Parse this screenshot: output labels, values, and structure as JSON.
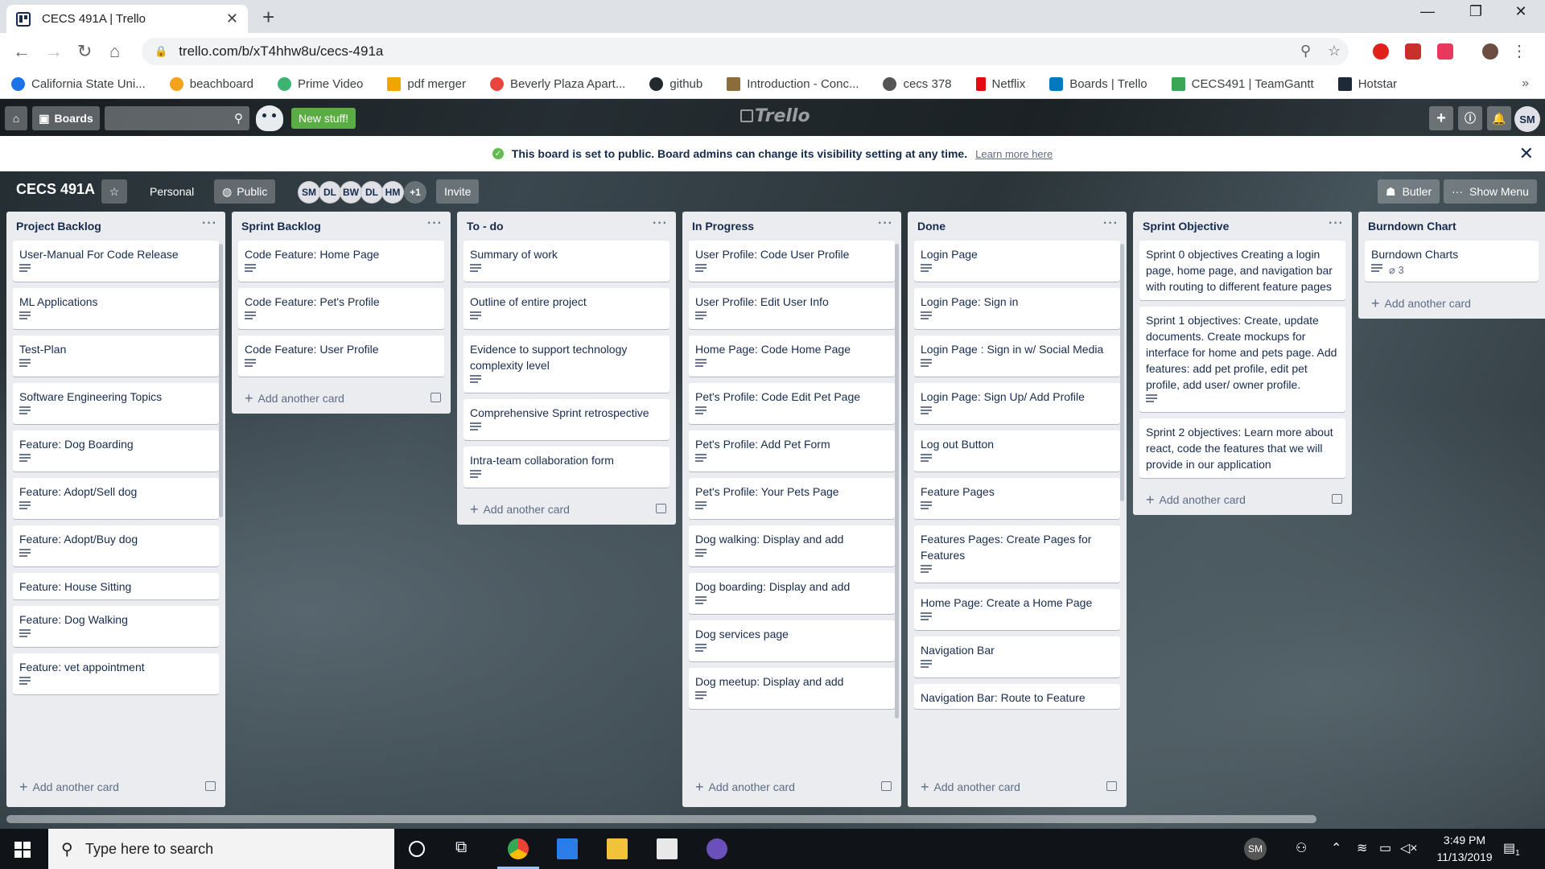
{
  "browser": {
    "tab_title": "CECS 491A | Trello",
    "url": "trello.com/b/xT4hhw8u/cecs-491a",
    "bookmarks": [
      {
        "label": "California State Uni...",
        "color": "#1a73e8"
      },
      {
        "label": "beachboard",
        "color": "#f4a11d"
      },
      {
        "label": "Prime Video",
        "color": "#3cb371"
      },
      {
        "label": "pdf merger",
        "color": "#f0a500"
      },
      {
        "label": "Beverly Plaza Apart...",
        "color": "#e8453c"
      },
      {
        "label": "github",
        "color": "#24292e"
      },
      {
        "label": "Introduction - Conc...",
        "color": "#8a6d3b"
      },
      {
        "label": "cecs 378",
        "color": "#555555"
      },
      {
        "label": "Netflix",
        "color": "#e50914"
      },
      {
        "label": "Boards | Trello",
        "color": "#0079bf"
      },
      {
        "label": "CECS491 | TeamGantt",
        "color": "#3aa757"
      },
      {
        "label": "Hotstar",
        "color": "#1f2a38"
      }
    ]
  },
  "trello": {
    "boards_label": "Boards",
    "new_stuff": "New stuff!",
    "logo": "Trello",
    "user_initials": "SM"
  },
  "notice": {
    "message": "This board is set to public. Board admins can change its visibility setting at any time.",
    "link": "Learn more here"
  },
  "board": {
    "title": "CECS 491A",
    "team": "Personal",
    "visibility": "Public",
    "members": [
      "SM",
      "DL",
      "BW",
      "DL",
      "HM"
    ],
    "extra_members": "+1",
    "invite": "Invite",
    "butler": "Butler",
    "show_menu": "Show Menu",
    "add_card_label": "Add another card"
  },
  "lists": [
    {
      "title": "Project Backlog",
      "cards": [
        {
          "text": "User-Manual For Code Release",
          "desc": true
        },
        {
          "text": "ML Applications",
          "desc": true
        },
        {
          "text": "Test-Plan",
          "desc": true
        },
        {
          "text": "Software Engineering Topics",
          "desc": true
        },
        {
          "text": "Feature: Dog Boarding",
          "desc": true
        },
        {
          "text": "Feature: Adopt/Sell dog",
          "desc": true
        },
        {
          "text": "Feature: Adopt/Buy dog",
          "desc": true
        },
        {
          "text": "Feature: House Sitting",
          "desc": false
        },
        {
          "text": "Feature: Dog Walking",
          "desc": true
        },
        {
          "text": "Feature: vet appointment",
          "desc": true
        }
      ]
    },
    {
      "title": "Sprint Backlog",
      "cards": [
        {
          "text": "Code Feature: Home Page",
          "desc": true
        },
        {
          "text": "Code Feature: Pet's Profile",
          "desc": true
        },
        {
          "text": "Code Feature: User Profile",
          "desc": true
        }
      ]
    },
    {
      "title": "To - do",
      "cards": [
        {
          "text": "Summary of work",
          "desc": true
        },
        {
          "text": "Outline of entire project",
          "desc": true
        },
        {
          "text": "Evidence to support technology complexity level",
          "desc": true
        },
        {
          "text": "Comprehensive Sprint retrospective",
          "desc": true
        },
        {
          "text": "Intra-team collaboration form",
          "desc": true
        }
      ]
    },
    {
      "title": "In Progress",
      "cards": [
        {
          "text": "User Profile: Code User Profile",
          "desc": true
        },
        {
          "text": "User Profile: Edit User Info",
          "desc": true
        },
        {
          "text": "Home Page: Code Home Page",
          "desc": true
        },
        {
          "text": "Pet's Profile: Code Edit Pet Page",
          "desc": true
        },
        {
          "text": "Pet's Profile: Add Pet Form",
          "desc": true
        },
        {
          "text": "Pet's Profile: Your Pets Page",
          "desc": true
        },
        {
          "text": "Dog walking: Display and add",
          "desc": true
        },
        {
          "text": "Dog boarding: Display and add",
          "desc": true
        },
        {
          "text": "Dog services page",
          "desc": true
        },
        {
          "text": "Dog meetup: Display and add",
          "desc": true
        }
      ]
    },
    {
      "title": "Done",
      "cards": [
        {
          "text": "Login Page",
          "desc": true
        },
        {
          "text": "Login Page: Sign in",
          "desc": true
        },
        {
          "text": "Login Page : Sign in w/ Social Media",
          "desc": true
        },
        {
          "text": "Login Page: Sign Up/ Add Profile",
          "desc": true
        },
        {
          "text": "Log out Button",
          "desc": true
        },
        {
          "text": "Feature Pages",
          "desc": true
        },
        {
          "text": "Features Pages: Create Pages for Features",
          "desc": true
        },
        {
          "text": "Home Page: Create a Home Page",
          "desc": true
        },
        {
          "text": "Navigation Bar",
          "desc": true
        },
        {
          "text": "Navigation Bar: Route to Feature",
          "desc": false
        }
      ]
    },
    {
      "title": "Sprint Objective",
      "cards": [
        {
          "text": "Sprint 0 objectives Creating a login page, home page, and navigation bar with routing to different feature pages",
          "desc": false
        },
        {
          "text": "Sprint 1 objectives: Create, update documents. Create mockups for interface for home and pets page. Add features: add pet profile, edit pet profile, add user/ owner profile.",
          "desc": true
        },
        {
          "text": "Sprint 2 objectives: Learn more about react, code the features that we will provide in our application",
          "desc": false
        }
      ]
    },
    {
      "title": "Burndown Chart",
      "cards": [
        {
          "text": "Burndown Charts",
          "desc": true,
          "attachments": "3"
        }
      ]
    }
  ],
  "taskbar": {
    "search_placeholder": "Type here to search",
    "user": "SM",
    "time": "3:49 PM",
    "date": "11/13/2019",
    "notifications": "1"
  }
}
